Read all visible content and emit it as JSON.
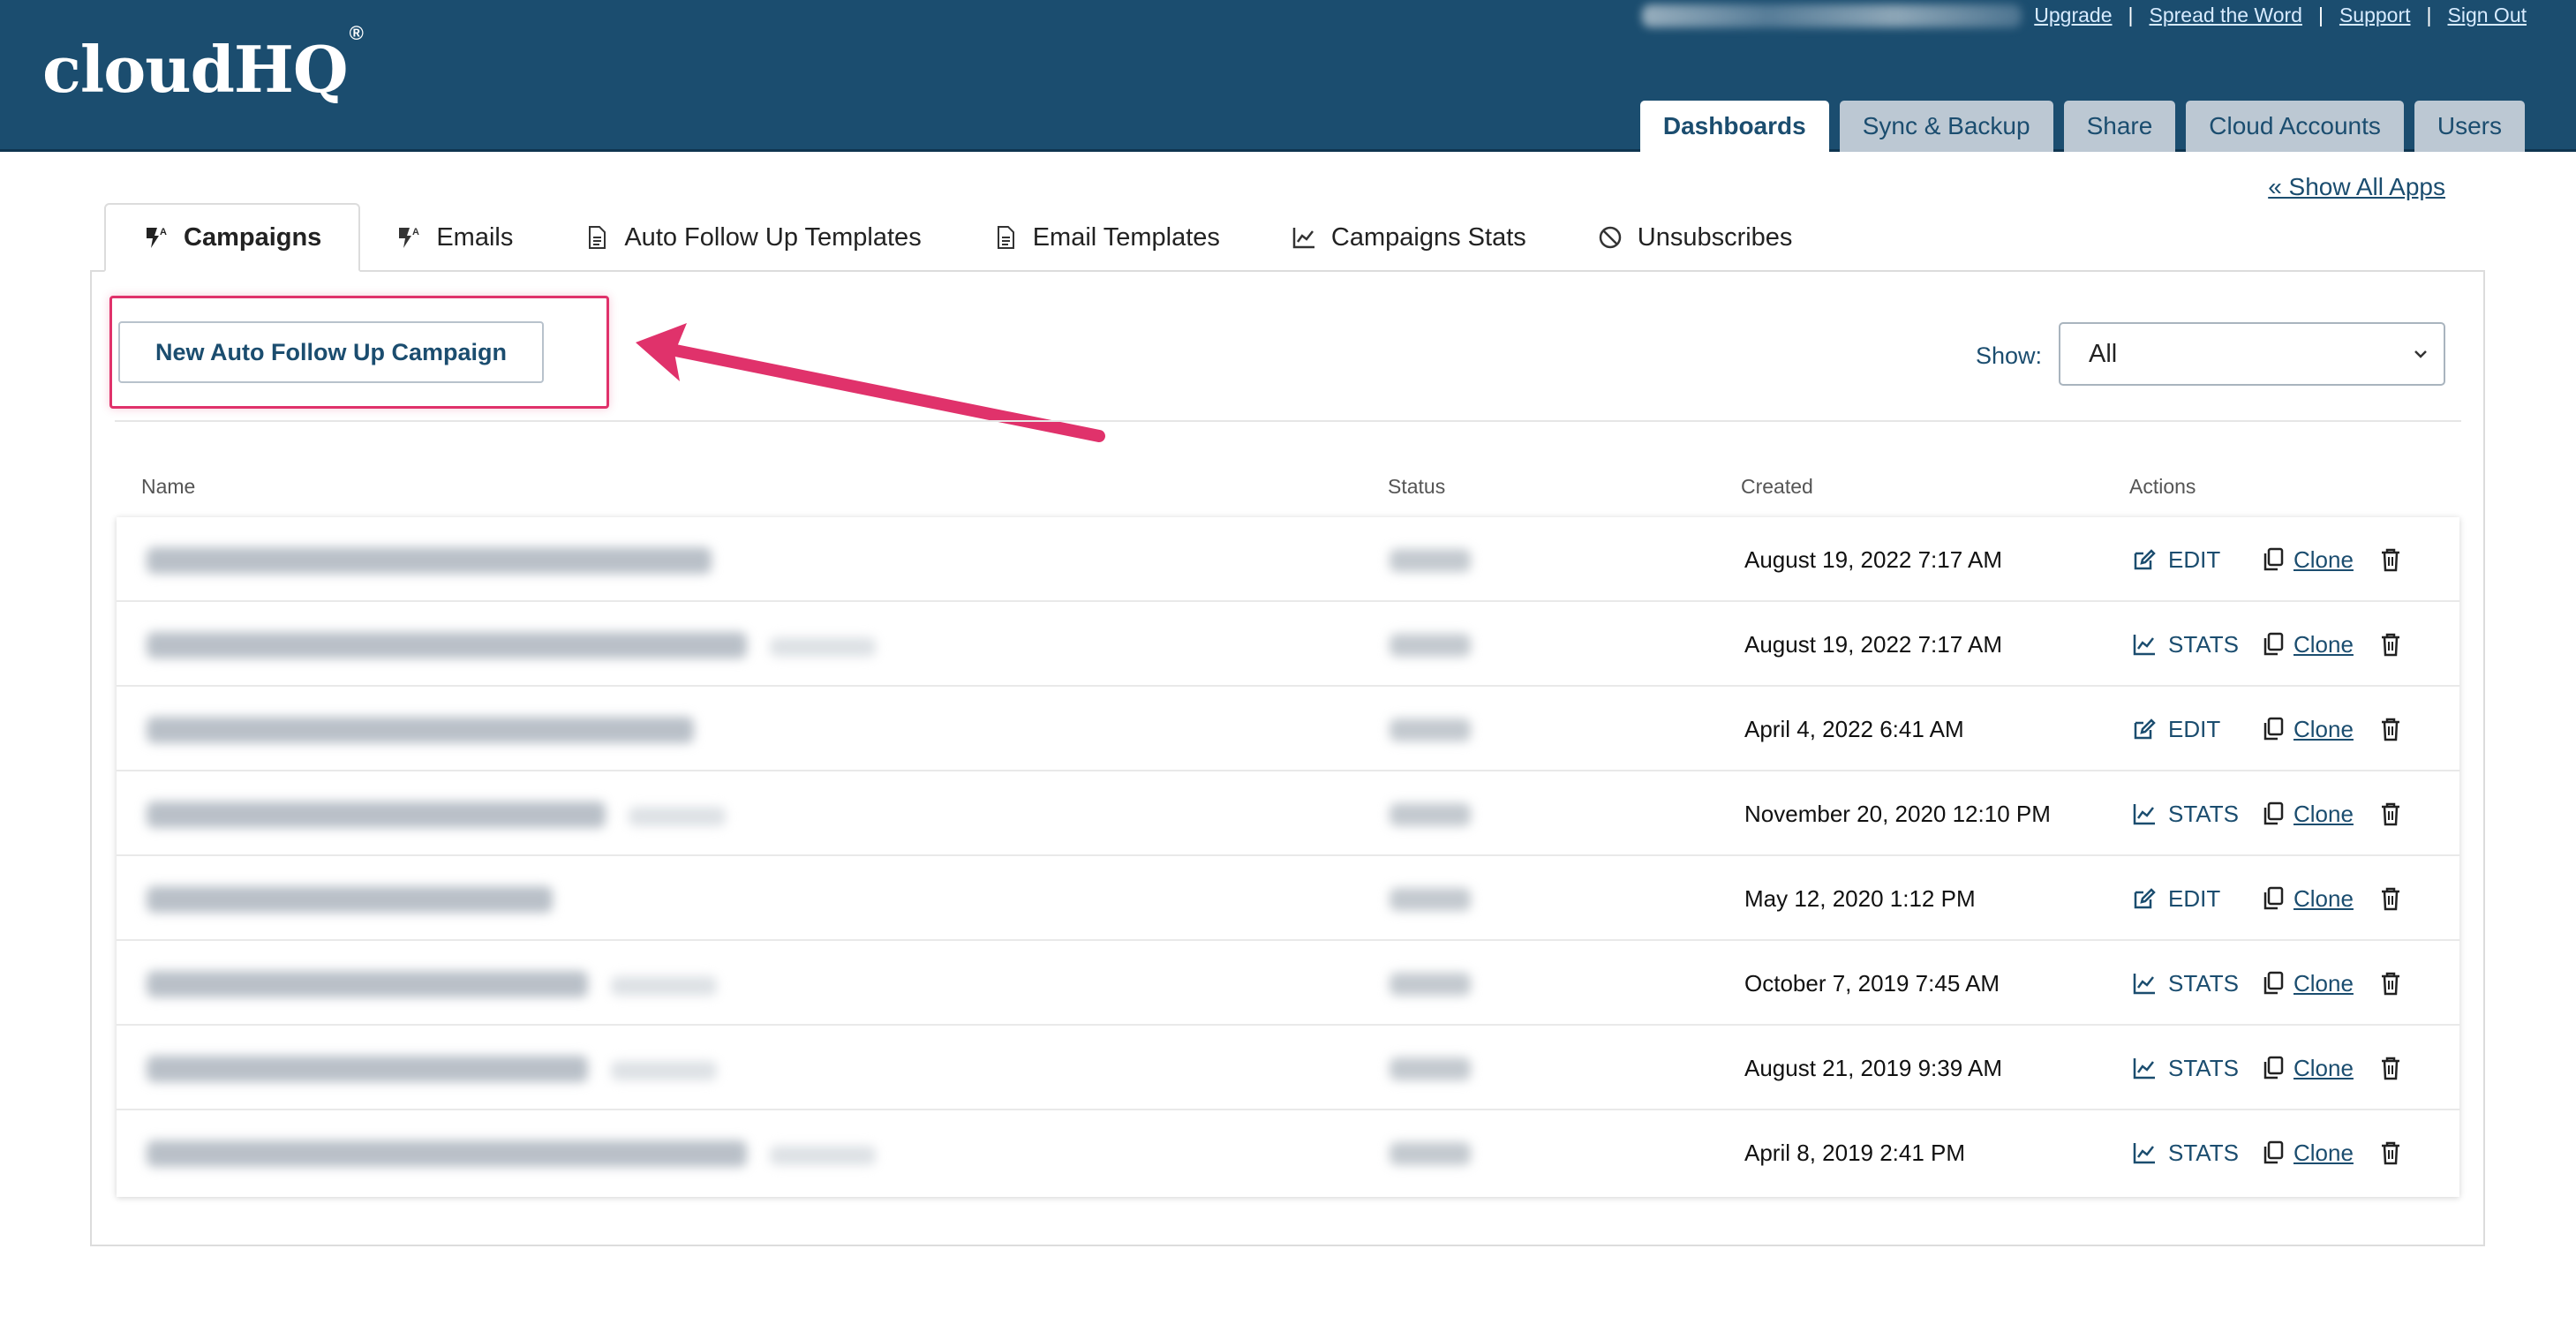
{
  "header": {
    "logo_text": "cloudHQ",
    "logo_mark": "®",
    "top_links": [
      "Upgrade",
      "Spread the Word",
      "Support",
      "Sign Out"
    ],
    "nav_tabs": [
      {
        "label": "Dashboards",
        "active": true
      },
      {
        "label": "Sync & Backup",
        "active": false
      },
      {
        "label": "Share",
        "active": false
      },
      {
        "label": "Cloud Accounts",
        "active": false
      },
      {
        "label": "Users",
        "active": false
      }
    ]
  },
  "show_all_apps": "« Show All Apps",
  "subtabs": [
    {
      "label": "Campaigns",
      "icon": "campaign-icon",
      "active": true
    },
    {
      "label": "Emails",
      "icon": "campaign-icon",
      "active": false
    },
    {
      "label": "Auto Follow Up Templates",
      "icon": "document-icon",
      "active": false
    },
    {
      "label": "Email Templates",
      "icon": "document-icon",
      "active": false
    },
    {
      "label": "Campaigns Stats",
      "icon": "chart-line-icon",
      "active": false
    },
    {
      "label": "Unsubscribes",
      "icon": "ban-icon",
      "active": false
    }
  ],
  "new_campaign_button": "New Auto Follow Up Campaign",
  "filter": {
    "label": "Show:",
    "selected": "All"
  },
  "table": {
    "columns": [
      "Name",
      "Status",
      "Created",
      "Actions"
    ],
    "clone_label": "Clone",
    "rows": [
      {
        "created": "August 19, 2022 7:17 AM",
        "action": "EDIT"
      },
      {
        "created": "August 19, 2022 7:17 AM",
        "action": "STATS"
      },
      {
        "created": "April 4, 2022 6:41 AM",
        "action": "EDIT"
      },
      {
        "created": "November 20, 2020 12:10 PM",
        "action": "STATS"
      },
      {
        "created": "May 12, 2020 1:12 PM",
        "action": "EDIT"
      },
      {
        "created": "October 7, 2019 7:45 AM",
        "action": "STATS"
      },
      {
        "created": "August 21, 2019 9:39 AM",
        "action": "STATS"
      },
      {
        "created": "April 8, 2019 2:41 PM",
        "action": "STATS"
      }
    ]
  },
  "colors": {
    "brand_blue": "#1b4d6f",
    "highlight_pink": "#e0326b"
  }
}
